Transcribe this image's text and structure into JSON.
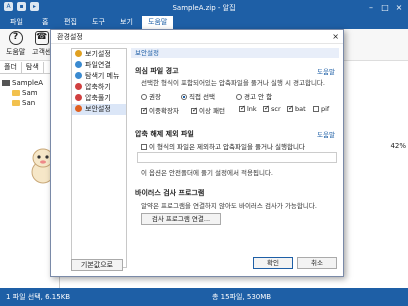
{
  "window": {
    "title": "SampleA.zip - 알집"
  },
  "menu": [
    "파일",
    "홈",
    "편집",
    "도구",
    "보기",
    "도움말"
  ],
  "ribbon": {
    "help_label": "도움말",
    "support_label": "고객센"
  },
  "left_pane": {
    "tabs": [
      "폴더",
      "탐색"
    ],
    "tree": [
      "SampleA",
      "Sam",
      "San"
    ]
  },
  "right_pane": {
    "percent": "42%"
  },
  "status": {
    "left": "1 파일 선택, 6.15KB",
    "mid": "총 15파일, 530MB"
  },
  "dialog": {
    "title": "환경설정",
    "nav": [
      {
        "label": "보기설정",
        "color": "#e0a020"
      },
      {
        "label": "파일연결",
        "color": "#3a8ad0"
      },
      {
        "label": "탐색기 메뉴",
        "color": "#3a8ad0"
      },
      {
        "label": "압축하기",
        "color": "#d04040"
      },
      {
        "label": "압축풀기",
        "color": "#d04040"
      },
      {
        "label": "보안설정",
        "color": "#e06020"
      }
    ],
    "reset_label": "기본값으로",
    "section_title": "보안설정",
    "warn": {
      "heading": "의심 파일 경고",
      "help": "도움말",
      "desc": "선택한 형식이 포함되어있는 압축파일을 풀거나 실행 시 경고합니다.",
      "radios": [
        "권장",
        "직접 선택",
        "경고 안 함"
      ],
      "checks": [
        "이중확장자",
        "이상 패턴",
        "lnk",
        "scr",
        "bat",
        "pif"
      ]
    },
    "exclude": {
      "heading": "압축 해제 제외 파일",
      "help": "도움말",
      "check": "이 형식의 파일은 제외하고 압축파일을 풀거나 실행합니다",
      "desc": "이 옵션은 안전폴더에 풀기 설정에서 적용됩니다."
    },
    "virus": {
      "heading": "바이러스 검사 프로그램",
      "desc": "알약은 프로그램을 연결하지 않아도 바이러스 검사가 가능합니다.",
      "button": "검사 프로그램 연결..."
    },
    "ok": "확인",
    "cancel": "취소"
  }
}
